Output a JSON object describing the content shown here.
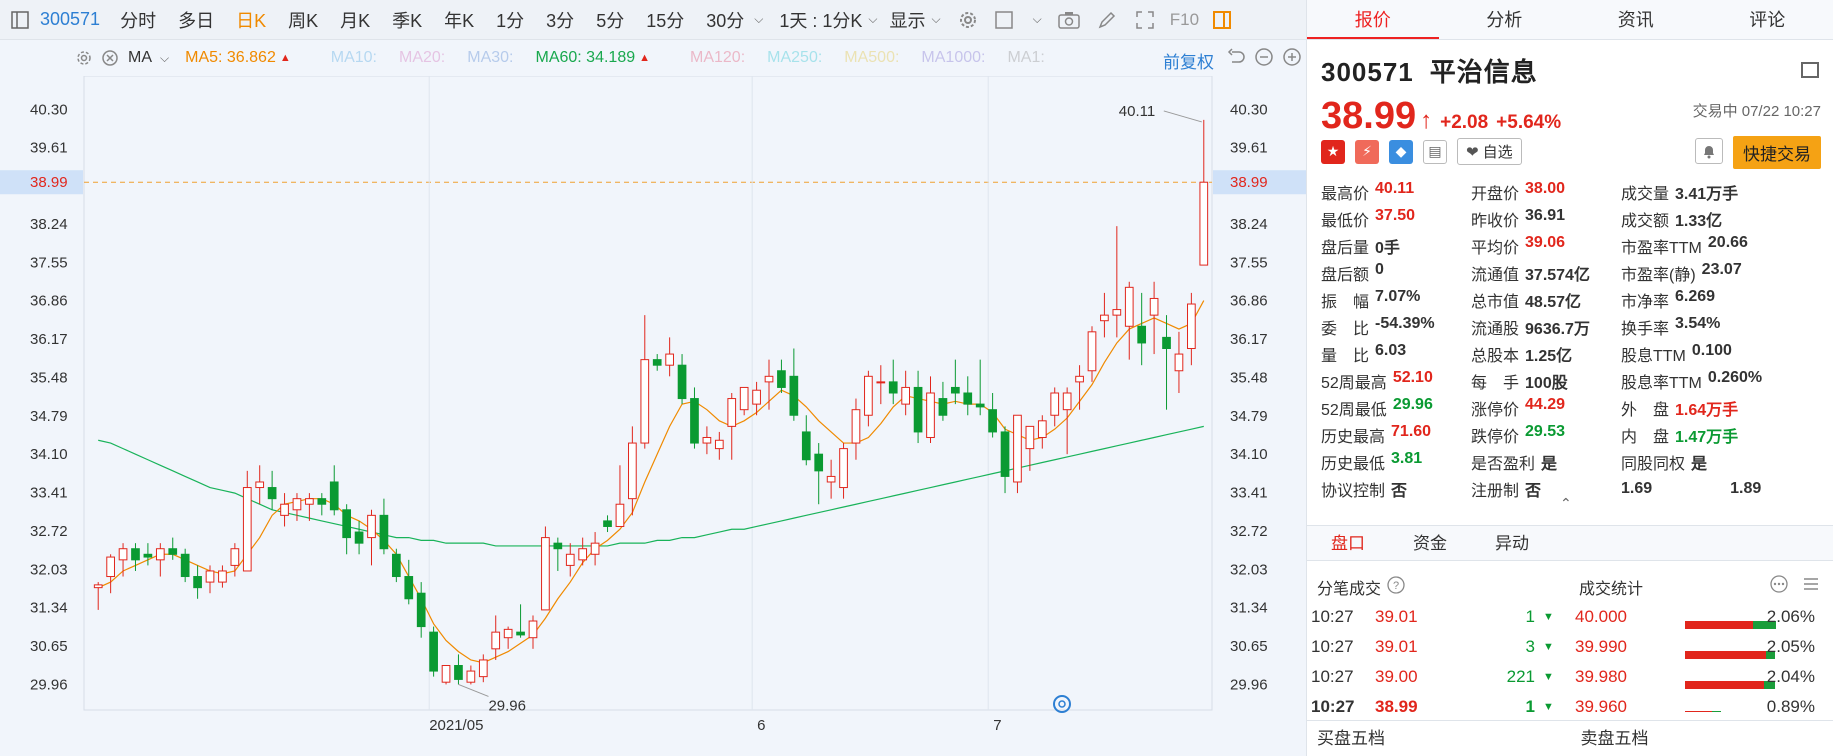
{
  "toolbar": {
    "code": "300571",
    "periods": [
      "分时",
      "多日",
      "日K",
      "周K",
      "月K",
      "季K",
      "年K",
      "1分",
      "3分",
      "5分",
      "15分",
      "30分"
    ],
    "active_period": "日K",
    "interval_label": "1天 : 1分K",
    "display_label": "显示",
    "f10_label": "F10"
  },
  "ma_bar": {
    "indicator": "MA",
    "ma5": "MA5: 36.862",
    "ma10": "MA10:",
    "ma20": "MA20:",
    "ma30": "MA30:",
    "ma60": "MA60: 34.189",
    "ma120": "MA120:",
    "ma250": "MA250:",
    "ma500": "MA500:",
    "ma1000": "MA1000:",
    "ma1": "MA1:",
    "adjust": "前复权"
  },
  "colors": {
    "up": "#e1261c",
    "down": "#0a9a32",
    "ma5": "#f08a00",
    "ma60": "#19b35a",
    "accent": "#2d7fd3"
  },
  "chart_data": {
    "type": "candlestick",
    "y_ticks": [
      "40.30",
      "39.61",
      "38.99",
      "38.24",
      "37.55",
      "36.86",
      "36.17",
      "35.48",
      "34.79",
      "34.10",
      "33.41",
      "32.72",
      "32.03",
      "31.34",
      "30.65",
      "29.96"
    ],
    "current_price_label": "38.99",
    "current_price": 38.99,
    "high_annotation": "40.11",
    "low_annotation": "29.96",
    "x_labels": [
      "2021/05",
      "6",
      "7"
    ],
    "ylim": [
      29.5,
      40.9
    ],
    "candles": [
      [
        31.7,
        31.8,
        31.3,
        31.75
      ],
      [
        31.9,
        32.3,
        31.6,
        32.25
      ],
      [
        32.2,
        32.5,
        31.9,
        32.4
      ],
      [
        32.4,
        32.5,
        32.0,
        32.2
      ],
      [
        32.3,
        32.5,
        32.1,
        32.25
      ],
      [
        32.2,
        32.5,
        31.9,
        32.4
      ],
      [
        32.4,
        32.6,
        32.2,
        32.3
      ],
      [
        32.3,
        32.4,
        31.8,
        31.9
      ],
      [
        31.9,
        32.1,
        31.5,
        31.7
      ],
      [
        31.8,
        32.1,
        31.6,
        32.0
      ],
      [
        31.8,
        32.1,
        31.7,
        32.0
      ],
      [
        32.1,
        32.5,
        31.9,
        32.4
      ],
      [
        32.0,
        33.8,
        32.0,
        33.5
      ],
      [
        33.5,
        33.9,
        33.2,
        33.6
      ],
      [
        33.5,
        33.8,
        33.1,
        33.3
      ],
      [
        33.0,
        33.4,
        32.8,
        33.2
      ],
      [
        33.1,
        33.4,
        32.9,
        33.3
      ],
      [
        33.2,
        33.4,
        32.9,
        33.3
      ],
      [
        33.3,
        33.4,
        33.0,
        33.2
      ],
      [
        33.6,
        33.9,
        33.0,
        33.1
      ],
      [
        33.1,
        33.2,
        32.3,
        32.6
      ],
      [
        32.7,
        32.9,
        32.3,
        32.5
      ],
      [
        32.6,
        33.1,
        32.1,
        33.0
      ],
      [
        33.0,
        33.3,
        32.3,
        32.4
      ],
      [
        32.3,
        32.4,
        31.8,
        31.9
      ],
      [
        31.9,
        32.2,
        31.4,
        31.5
      ],
      [
        31.6,
        31.8,
        30.8,
        31.0
      ],
      [
        30.9,
        31.0,
        30.1,
        30.2
      ],
      [
        30.0,
        30.1,
        29.96,
        30.3
      ],
      [
        30.3,
        30.5,
        29.96,
        30.05
      ],
      [
        30.0,
        30.3,
        29.96,
        30.2
      ],
      [
        30.1,
        30.5,
        30.0,
        30.4
      ],
      [
        30.6,
        31.2,
        30.4,
        30.9
      ],
      [
        30.8,
        31.0,
        30.6,
        30.95
      ],
      [
        30.9,
        31.4,
        30.8,
        30.85
      ],
      [
        30.8,
        31.2,
        30.6,
        31.1
      ],
      [
        31.3,
        32.8,
        31.3,
        32.6
      ],
      [
        32.5,
        32.6,
        32.0,
        32.4
      ],
      [
        32.1,
        32.5,
        31.9,
        32.3
      ],
      [
        32.2,
        32.6,
        32.1,
        32.4
      ],
      [
        32.3,
        32.7,
        32.1,
        32.5
      ],
      [
        32.9,
        33.0,
        32.7,
        32.8
      ],
      [
        32.8,
        33.9,
        32.8,
        33.2
      ],
      [
        33.3,
        34.6,
        33.0,
        34.3
      ],
      [
        34.3,
        36.6,
        34.2,
        35.8
      ],
      [
        35.8,
        35.9,
        35.6,
        35.7
      ],
      [
        35.7,
        36.2,
        35.5,
        35.9
      ],
      [
        35.7,
        35.9,
        35.0,
        35.1
      ],
      [
        35.1,
        35.3,
        34.2,
        34.3
      ],
      [
        34.3,
        34.6,
        34.1,
        34.4
      ],
      [
        34.2,
        34.5,
        34.0,
        34.35
      ],
      [
        34.6,
        35.2,
        34.0,
        35.1
      ],
      [
        34.9,
        35.3,
        34.8,
        35.3
      ],
      [
        35.0,
        35.4,
        34.8,
        35.25
      ],
      [
        35.4,
        35.8,
        34.9,
        35.5
      ],
      [
        35.6,
        35.8,
        35.2,
        35.3
      ],
      [
        35.5,
        36.0,
        34.7,
        34.8
      ],
      [
        34.5,
        34.8,
        33.9,
        34.0
      ],
      [
        34.1,
        34.3,
        33.2,
        33.8
      ],
      [
        33.6,
        34.0,
        33.3,
        33.7
      ],
      [
        33.5,
        34.3,
        33.3,
        34.2
      ],
      [
        34.3,
        35.1,
        34.0,
        34.9
      ],
      [
        34.8,
        35.6,
        34.6,
        35.5
      ],
      [
        35.4,
        35.7,
        35.0,
        35.4
      ],
      [
        35.4,
        35.8,
        35.0,
        35.2
      ],
      [
        35.0,
        35.6,
        34.8,
        35.3
      ],
      [
        35.3,
        35.6,
        34.3,
        34.5
      ],
      [
        34.4,
        35.5,
        34.3,
        35.2
      ],
      [
        35.1,
        35.4,
        34.7,
        34.8
      ],
      [
        35.3,
        35.8,
        35.0,
        35.2
      ],
      [
        35.2,
        35.5,
        34.8,
        35.0
      ],
      [
        35.0,
        35.8,
        34.8,
        34.95
      ],
      [
        34.9,
        35.2,
        34.4,
        34.5
      ],
      [
        34.5,
        34.6,
        33.4,
        33.7
      ],
      [
        33.6,
        34.8,
        33.4,
        34.8
      ],
      [
        34.2,
        34.6,
        33.8,
        34.6
      ],
      [
        34.4,
        34.8,
        34.2,
        34.7
      ],
      [
        34.8,
        35.3,
        34.6,
        35.2
      ],
      [
        34.9,
        35.3,
        34.1,
        35.2
      ],
      [
        35.4,
        35.7,
        34.9,
        35.5
      ],
      [
        35.6,
        36.4,
        35.4,
        36.3
      ],
      [
        36.5,
        37.0,
        36.2,
        36.6
      ],
      [
        36.6,
        38.2,
        36.2,
        36.7
      ],
      [
        36.4,
        37.2,
        35.8,
        37.1
      ],
      [
        36.4,
        37.0,
        35.7,
        36.1
      ],
      [
        36.6,
        37.2,
        35.9,
        36.9
      ],
      [
        36.2,
        36.6,
        34.9,
        36.0
      ],
      [
        35.6,
        36.3,
        35.2,
        35.9
      ],
      [
        36.0,
        37.0,
        35.7,
        36.8
      ],
      [
        37.5,
        40.11,
        37.5,
        38.99
      ]
    ],
    "ma5": [
      31.7,
      31.8,
      32.0,
      32.1,
      32.2,
      32.3,
      32.3,
      32.2,
      32.1,
      32.0,
      31.95,
      32.0,
      32.3,
      32.6,
      33.0,
      33.2,
      33.25,
      33.3,
      33.3,
      33.2,
      33.0,
      32.9,
      32.75,
      32.55,
      32.3,
      31.9,
      31.5,
      31.05,
      30.75,
      30.55,
      30.4,
      30.35,
      30.45,
      30.55,
      30.7,
      30.85,
      31.15,
      31.5,
      31.8,
      32.15,
      32.4,
      32.55,
      32.75,
      33.05,
      33.6,
      34.1,
      34.6,
      35.0,
      35.05,
      34.9,
      34.7,
      34.6,
      34.7,
      34.85,
      35.05,
      35.25,
      35.15,
      34.95,
      34.7,
      34.5,
      34.3,
      34.3,
      34.4,
      34.65,
      34.95,
      35.15,
      35.1,
      35.05,
      35.0,
      35.05,
      35.0,
      35.0,
      34.85,
      34.55,
      34.45,
      34.35,
      34.4,
      34.55,
      34.75,
      35.05,
      35.35,
      35.75,
      36.1,
      36.35,
      36.45,
      36.55,
      36.45,
      36.35,
      36.45,
      36.862
    ],
    "ma60": [
      34.35,
      34.3,
      34.2,
      34.1,
      34.0,
      33.9,
      33.8,
      33.7,
      33.6,
      33.5,
      33.45,
      33.4,
      33.3,
      33.2,
      33.1,
      33.05,
      33.0,
      32.95,
      32.9,
      32.85,
      32.8,
      32.75,
      32.7,
      32.65,
      32.6,
      32.6,
      32.55,
      32.55,
      32.5,
      32.5,
      32.5,
      32.5,
      32.45,
      32.45,
      32.45,
      32.45,
      32.45,
      32.45,
      32.45,
      32.45,
      32.45,
      32.45,
      32.5,
      32.5,
      32.5,
      32.55,
      32.55,
      32.6,
      32.6,
      32.65,
      32.7,
      32.75,
      32.75,
      32.8,
      32.85,
      32.9,
      32.95,
      33.0,
      33.05,
      33.1,
      33.15,
      33.2,
      33.25,
      33.3,
      33.35,
      33.4,
      33.45,
      33.5,
      33.55,
      33.6,
      33.65,
      33.7,
      33.75,
      33.8,
      33.85,
      33.9,
      33.95,
      34.0,
      34.05,
      34.1,
      34.15,
      34.2,
      34.25,
      34.3,
      34.35,
      34.4,
      34.45,
      34.5,
      34.55,
      34.6
    ]
  },
  "quote": {
    "code": "300571",
    "name": "平治信息",
    "price": "38.99",
    "change": "+2.08",
    "change_pct": "+5.64%",
    "status": "交易中 07/22 10:27",
    "watch_label": "自选",
    "quick_trade_label": "快捷交易"
  },
  "right_tabs": [
    "报价",
    "分析",
    "资讯",
    "评论"
  ],
  "info_rows": [
    [
      {
        "l": "最高价",
        "v": "40.11",
        "c": "red"
      },
      {
        "l": "开盘价",
        "v": "38.00",
        "c": "red"
      },
      {
        "l": "成交量",
        "v": "3.41万手",
        "c": "dark"
      }
    ],
    [
      {
        "l": "最低价",
        "v": "37.50",
        "c": "red"
      },
      {
        "l": "昨收价",
        "v": "36.91",
        "c": "dark"
      },
      {
        "l": "成交额",
        "v": "1.33亿",
        "c": "dark"
      }
    ],
    [
      {
        "l": "盘后量",
        "v": "0手",
        "c": "dark"
      },
      {
        "l": "平均价",
        "v": "39.06",
        "c": "red"
      },
      {
        "l": "市盈率TTM",
        "v": "20.66",
        "c": "dark"
      }
    ],
    [
      {
        "l": "盘后额",
        "v": "0",
        "c": "dark"
      },
      {
        "l": "流通值",
        "v": "37.574亿",
        "c": "dark"
      },
      {
        "l": "市盈率(静)",
        "v": "23.07",
        "c": "dark"
      }
    ],
    [
      {
        "l": "振　幅",
        "v": "7.07%",
        "c": "dark"
      },
      {
        "l": "总市值",
        "v": "48.57亿",
        "c": "dark"
      },
      {
        "l": "市净率",
        "v": "6.269",
        "c": "dark"
      }
    ],
    [
      {
        "l": "委　比",
        "v": "-54.39%",
        "c": "dark"
      },
      {
        "l": "流通股",
        "v": "9636.7万",
        "c": "dark"
      },
      {
        "l": "换手率",
        "v": "3.54%",
        "c": "dark"
      }
    ],
    [
      {
        "l": "量　比",
        "v": "6.03",
        "c": "dark"
      },
      {
        "l": "总股本",
        "v": "1.25亿",
        "c": "dark"
      },
      {
        "l": "股息TTM",
        "v": "0.100",
        "c": "dark"
      }
    ],
    [
      {
        "l": "52周最高",
        "v": "52.10",
        "c": "red"
      },
      {
        "l": "每　手",
        "v": "100股",
        "c": "dark"
      },
      {
        "l": "股息率TTM",
        "v": "0.260%",
        "c": "dark"
      }
    ],
    [
      {
        "l": "52周最低",
        "v": "29.96",
        "c": "green"
      },
      {
        "l": "涨停价",
        "v": "44.29",
        "c": "red"
      },
      {
        "l": "外　盘",
        "v": "1.64万手",
        "c": "red"
      }
    ],
    [
      {
        "l": "历史最高",
        "v": "71.60",
        "c": "red"
      },
      {
        "l": "跌停价",
        "v": "29.53",
        "c": "green"
      },
      {
        "l": "内　盘",
        "v": "1.47万手",
        "c": "green"
      }
    ],
    [
      {
        "l": "历史最低",
        "v": "3.81",
        "c": "green"
      },
      {
        "l": "是否盈利",
        "v": "是",
        "c": "dark"
      },
      {
        "l": "同股同权",
        "v": "是",
        "c": "dark"
      }
    ],
    [
      {
        "l": "协议控制",
        "v": "否",
        "c": "dark"
      },
      {
        "l": "注册制",
        "v": "否",
        "c": "dark"
      },
      {
        "l": "1.69",
        "v": "1.89",
        "c": "dark"
      }
    ]
  ],
  "sub_tabs": [
    "盘口",
    "资金",
    "异动"
  ],
  "ticks_title": "分笔成交",
  "stats_title": "成交统计",
  "ticks": [
    {
      "t": "10:27",
      "p": "39.01",
      "v": "1"
    },
    {
      "t": "10:27",
      "p": "39.01",
      "v": "3"
    },
    {
      "t": "10:27",
      "p": "39.00",
      "v": "221"
    },
    {
      "t": "10:27",
      "p": "38.99",
      "v": "1"
    }
  ],
  "stats": [
    {
      "p": "40.000",
      "pct": "2.06%",
      "red": 0.75,
      "green": 0.25
    },
    {
      "p": "39.990",
      "pct": "2.05%",
      "red": 0.9,
      "green": 0.1
    },
    {
      "p": "39.980",
      "pct": "2.04%",
      "red": 0.88,
      "green": 0.12
    },
    {
      "p": "39.960",
      "pct": "0.89%",
      "red": 0.3,
      "green": 0.1
    }
  ],
  "bottom_tabs": [
    "买盘五档",
    "卖盘五档"
  ]
}
